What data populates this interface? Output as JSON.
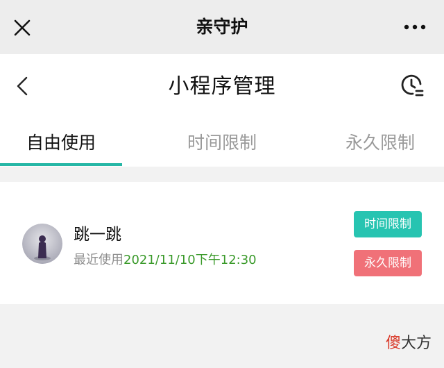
{
  "topbar": {
    "title": "亲守护",
    "close_icon": "close-icon",
    "more_icon": "more-dots-icon"
  },
  "navbar": {
    "title": "小程序管理",
    "back_icon": "chevron-left-icon",
    "history_icon": "clock-history-icon"
  },
  "tabs": [
    {
      "label": "自由使用",
      "active": true
    },
    {
      "label": "时间限制",
      "active": false
    },
    {
      "label": "永久限制",
      "active": false
    }
  ],
  "app_item": {
    "name": "跳一跳",
    "last_used_label": "最近使用",
    "last_used_value": "2021/11/10下午12:30",
    "time_limit_button": "时间限制",
    "permanent_limit_button": "永久限制"
  },
  "watermark": {
    "first_char": "傻",
    "rest": "大方"
  },
  "colors": {
    "accent": "#26b7a6",
    "time_button": "#27c4b1",
    "permanent_button": "#f07178",
    "timestamp": "#3a9a2a"
  }
}
